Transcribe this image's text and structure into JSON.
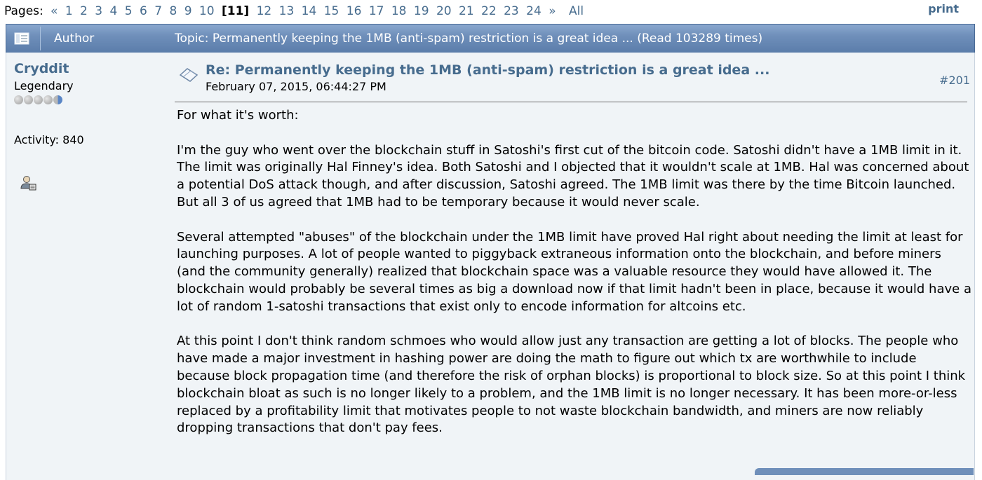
{
  "pagination": {
    "label": "Pages:",
    "prev": "«",
    "pages_before": [
      "1",
      "2",
      "3",
      "4",
      "5",
      "6",
      "7",
      "8",
      "9",
      "10"
    ],
    "current": "[11]",
    "pages_after": [
      "12",
      "13",
      "14",
      "15",
      "16",
      "17",
      "18",
      "19",
      "20",
      "21",
      "22",
      "23",
      "24"
    ],
    "next": "»",
    "all": "All",
    "print": "print"
  },
  "header": {
    "author_label": "Author",
    "topic": "Topic: Permanently keeping the 1MB (anti-spam) restriction is a great idea ...  (Read 103289 times)"
  },
  "poster": {
    "name": "Cryddit",
    "rank": "Legendary",
    "activity": "Activity: 840"
  },
  "post": {
    "subject": "Re: Permanently keeping the 1MB (anti-spam) restriction is a great idea ...",
    "date": "February 07, 2015, 06:44:27 PM",
    "number": "#201",
    "paragraphs": [
      "For what it's worth:",
      "I'm the guy who went over the blockchain stuff in Satoshi's first cut of the bitcoin code.  Satoshi didn't have a 1MB limit in it. The limit was originally Hal Finney's idea.  Both Satoshi and I objected that it wouldn't scale at 1MB.  Hal was concerned about a potential DoS attack though, and after discussion, Satoshi agreed.  The 1MB limit was there by the time Bitcoin launched.  But all 3 of us agreed that 1MB had to be temporary because it would never scale.",
      "Several attempted \"abuses\" of the blockchain under the 1MB limit have proved Hal right about needing the limit at least for launching purposes.  A lot of people wanted to piggyback extraneous information onto the blockchain, and before miners (and the community generally) realized that blockchain space was a valuable resource they would have allowed it.  The blockchain would probably be several times as big a download now if that limit hadn't been in place, because it would have a lot of random 1-satoshi transactions that exist only to encode information for altcoins etc.",
      "At this point I don't think random schmoes who would allow just any transaction are getting a  lot of blocks. The people who have made a major investment in hashing power are doing the math to figure out which tx are worthwhile to include because block propagation time (and therefore the risk of orphan blocks) is proportional to block size. So at this point I think blockchain bloat as such is no longer likely to a problem, and the 1MB limit is no longer necessary.  It has been more-or-less replaced by a profitability limit that motivates people to not waste blockchain bandwidth, and miners are now reliably dropping transactions that don't pay fees."
    ]
  }
}
